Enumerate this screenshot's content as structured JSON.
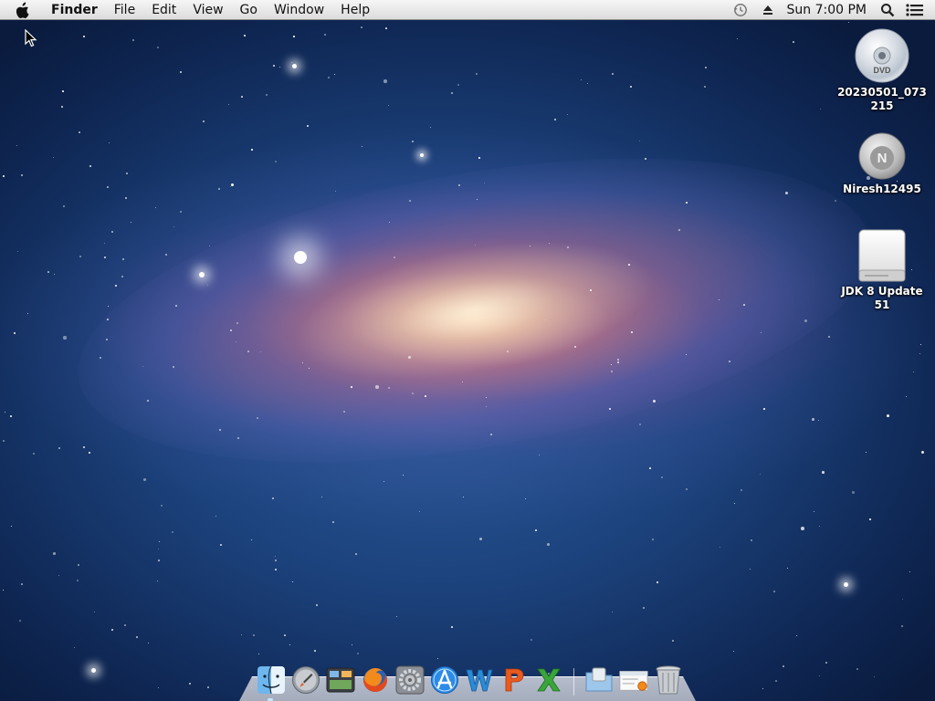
{
  "menubar": {
    "app_name": "Finder",
    "menus": [
      "File",
      "Edit",
      "View",
      "Go",
      "Window",
      "Help"
    ],
    "clock": "Sun 7:00 PM",
    "status_icons": [
      "time-machine-icon",
      "eject-icon",
      "spotlight-search-icon",
      "notification-center-icon"
    ]
  },
  "desktop": {
    "icons": [
      {
        "label": "20230501_073215",
        "icon": "dvd-disc-icon"
      },
      {
        "label": "Niresh12495",
        "icon": "install-disk-icon"
      },
      {
        "label": "JDK 8 Update 51",
        "icon": "external-drive-icon"
      }
    ]
  },
  "dock": {
    "apps": [
      {
        "name": "Finder",
        "icon": "finder-icon",
        "running": true
      },
      {
        "name": "Launchpad",
        "icon": "launchpad-icon",
        "running": false
      },
      {
        "name": "Mission Control",
        "icon": "mission-control-icon",
        "running": false
      },
      {
        "name": "Firefox",
        "icon": "firefox-icon",
        "running": false
      },
      {
        "name": "System Preferences",
        "icon": "system-preferences-icon",
        "running": false
      },
      {
        "name": "App Store",
        "icon": "app-store-icon",
        "running": false
      },
      {
        "name": "Word",
        "icon": "word-icon",
        "running": false
      },
      {
        "name": "PowerPoint",
        "icon": "powerpoint-icon",
        "running": false
      },
      {
        "name": "Excel",
        "icon": "excel-icon",
        "running": false
      }
    ],
    "others": [
      {
        "name": "Applications",
        "icon": "applications-folder-icon"
      },
      {
        "name": "Downloads",
        "icon": "downloads-stack-icon"
      },
      {
        "name": "Trash",
        "icon": "trash-icon"
      }
    ]
  }
}
